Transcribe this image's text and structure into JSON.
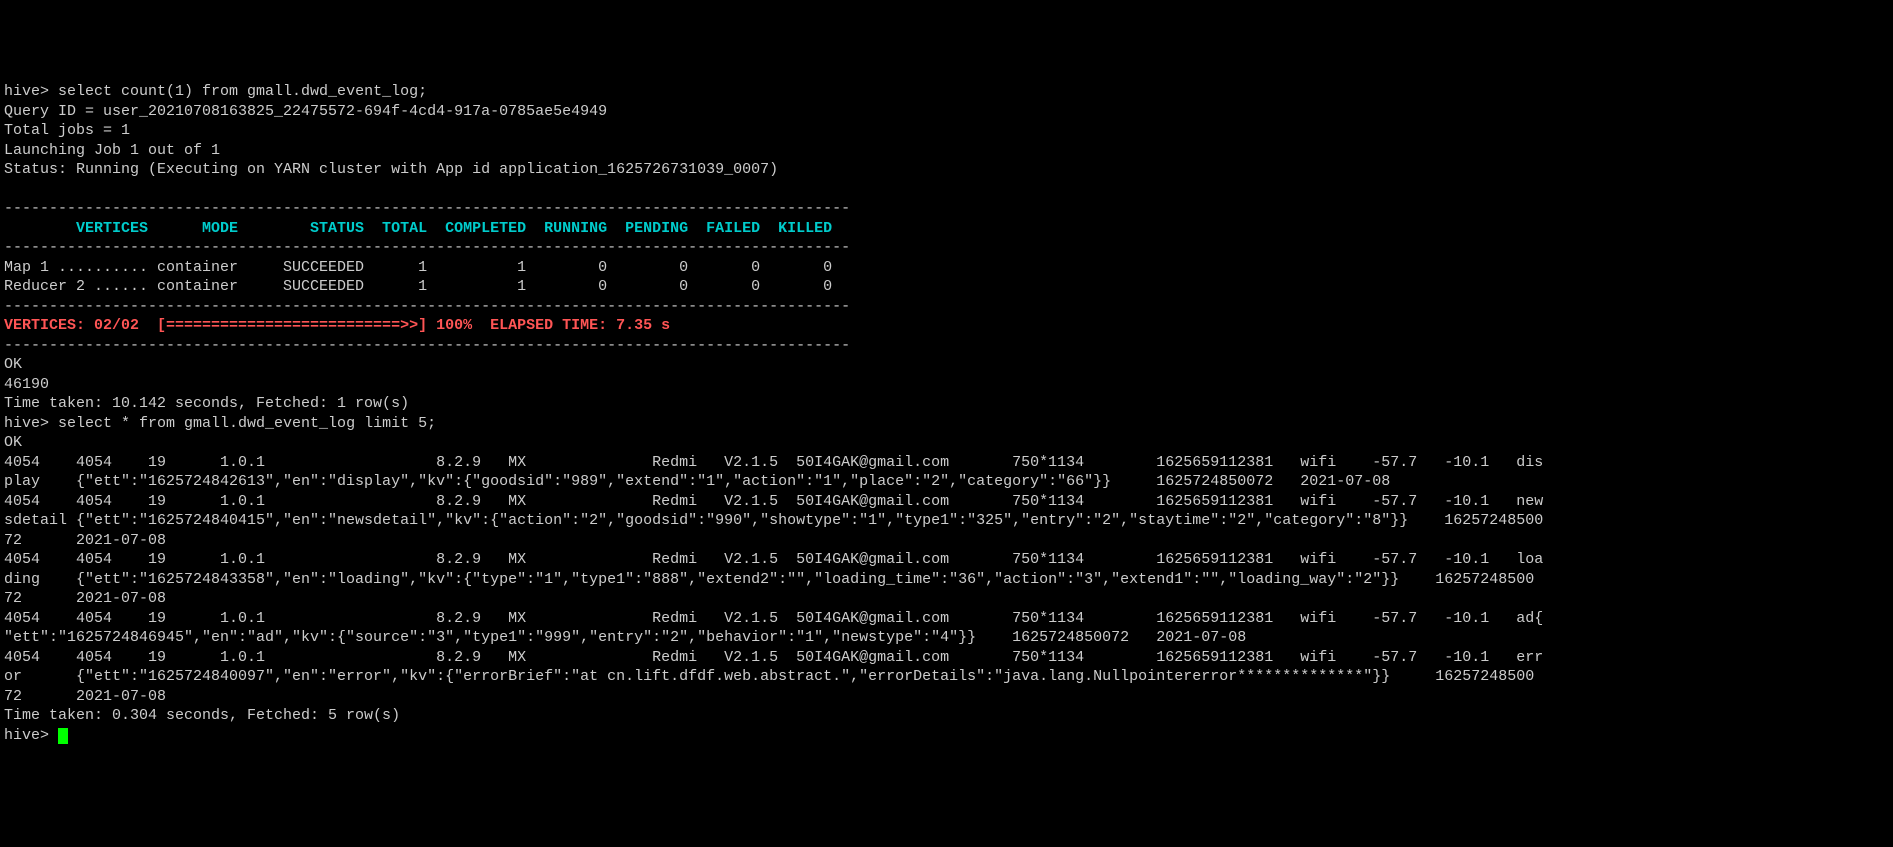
{
  "terminal": {
    "prompt1": "hive> ",
    "query1": "select count(1) from gmall.dwd_event_log;",
    "queryId": "Query ID = user_20210708163825_22475572-694f-4cd4-917a-0785ae5e4949",
    "totalJobs": "Total jobs = 1",
    "launching": "Launching Job 1 out of 1",
    "status": "Status: Running (Executing on YARN cluster with App id application_1625726731039_0007)",
    "dashLine1": "----------------------------------------------------------------------------------------------",
    "header": "        VERTICES      MODE        STATUS  TOTAL  COMPLETED  RUNNING  PENDING  FAILED  KILLED",
    "dashLine2": "----------------------------------------------------------------------------------------------",
    "map1": "Map 1 .......... container     SUCCEEDED      1          1        0        0       0       0",
    "reducer2": "Reducer 2 ...... container     SUCCEEDED      1          1        0        0       0       0",
    "dashLine3": "----------------------------------------------------------------------------------------------",
    "vertices": "VERTICES: 02/02  [==========================>>] 100%  ELAPSED TIME: 7.35 s",
    "dashLine4": "----------------------------------------------------------------------------------------------",
    "ok1": "OK",
    "count": "46190",
    "timeTaken1": "Time taken: 10.142 seconds, Fetched: 1 row(s)",
    "prompt2": "hive> ",
    "query2": "select * from gmall.dwd_event_log limit 5;",
    "ok2": "OK",
    "row1a": "4054    4054    19      1.0.1                   8.2.9   MX              Redmi   V2.1.5  50I4GAK@gmail.com       750*1134        1625659112381   wifi    -57.7   -10.1   dis",
    "row1b": "play    {\"ett\":\"1625724842613\",\"en\":\"display\",\"kv\":{\"goodsid\":\"989\",\"extend\":\"1\",\"action\":\"1\",\"place\":\"2\",\"category\":\"66\"}}     1625724850072   2021-07-08",
    "row2a": "4054    4054    19      1.0.1                   8.2.9   MX              Redmi   V2.1.5  50I4GAK@gmail.com       750*1134        1625659112381   wifi    -57.7   -10.1   new",
    "row2b": "sdetail {\"ett\":\"1625724840415\",\"en\":\"newsdetail\",\"kv\":{\"action\":\"2\",\"goodsid\":\"990\",\"showtype\":\"1\",\"type1\":\"325\",\"entry\":\"2\",\"staytime\":\"2\",\"category\":\"8\"}}    16257248500",
    "row2c": "72      2021-07-08",
    "row3a": "4054    4054    19      1.0.1                   8.2.9   MX              Redmi   V2.1.5  50I4GAK@gmail.com       750*1134        1625659112381   wifi    -57.7   -10.1   loa",
    "row3b": "ding    {\"ett\":\"1625724843358\",\"en\":\"loading\",\"kv\":{\"type\":\"1\",\"type1\":\"888\",\"extend2\":\"\",\"loading_time\":\"36\",\"action\":\"3\",\"extend1\":\"\",\"loading_way\":\"2\"}}    16257248500",
    "row3c": "72      2021-07-08",
    "row4a": "4054    4054    19      1.0.1                   8.2.9   MX              Redmi   V2.1.5  50I4GAK@gmail.com       750*1134        1625659112381   wifi    -57.7   -10.1   ad{",
    "row4b": "\"ett\":\"1625724846945\",\"en\":\"ad\",\"kv\":{\"source\":\"3\",\"type1\":\"999\",\"entry\":\"2\",\"behavior\":\"1\",\"newstype\":\"4\"}}    1625724850072   2021-07-08",
    "row5a": "4054    4054    19      1.0.1                   8.2.9   MX              Redmi   V2.1.5  50I4GAK@gmail.com       750*1134        1625659112381   wifi    -57.7   -10.1   err",
    "row5b": "or      {\"ett\":\"1625724840097\",\"en\":\"error\",\"kv\":{\"errorBrief\":\"at cn.lift.dfdf.web.abstract.\",\"errorDetails\":\"java.lang.Nullpointererror**************\"}}     16257248500",
    "row5c": "72      2021-07-08",
    "timeTaken2": "Time taken: 0.304 seconds, Fetched: 5 row(s)",
    "prompt3": "hive> "
  }
}
